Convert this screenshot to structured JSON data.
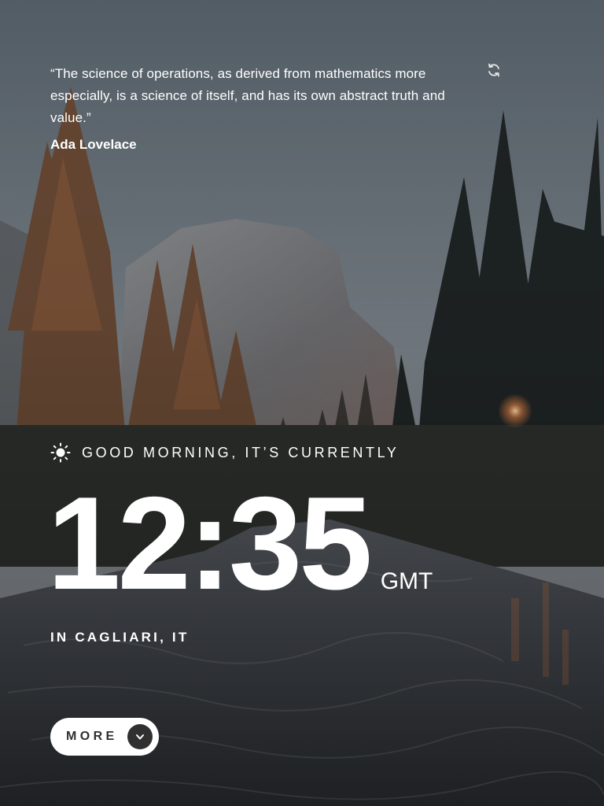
{
  "quote": {
    "text": "“The science of operations, as derived from mathematics more especially, is a science of itself, and has its own abstract truth and value.”",
    "author": "Ada Lovelace",
    "refresh_icon": "refresh-icon"
  },
  "clock": {
    "greeting": "GOOD MORNING, IT’S CURRENTLY",
    "greeting_icon": "sun-icon",
    "time": "12:35",
    "timezone": "GMT",
    "location": "IN CAGLIARI, IT"
  },
  "more_button": {
    "label": "MORE",
    "icon": "chevron-down-icon"
  },
  "colors": {
    "text": "#ffffff",
    "button_bg": "#ffffff",
    "button_text": "#303030",
    "chevron_bg": "#303030"
  }
}
